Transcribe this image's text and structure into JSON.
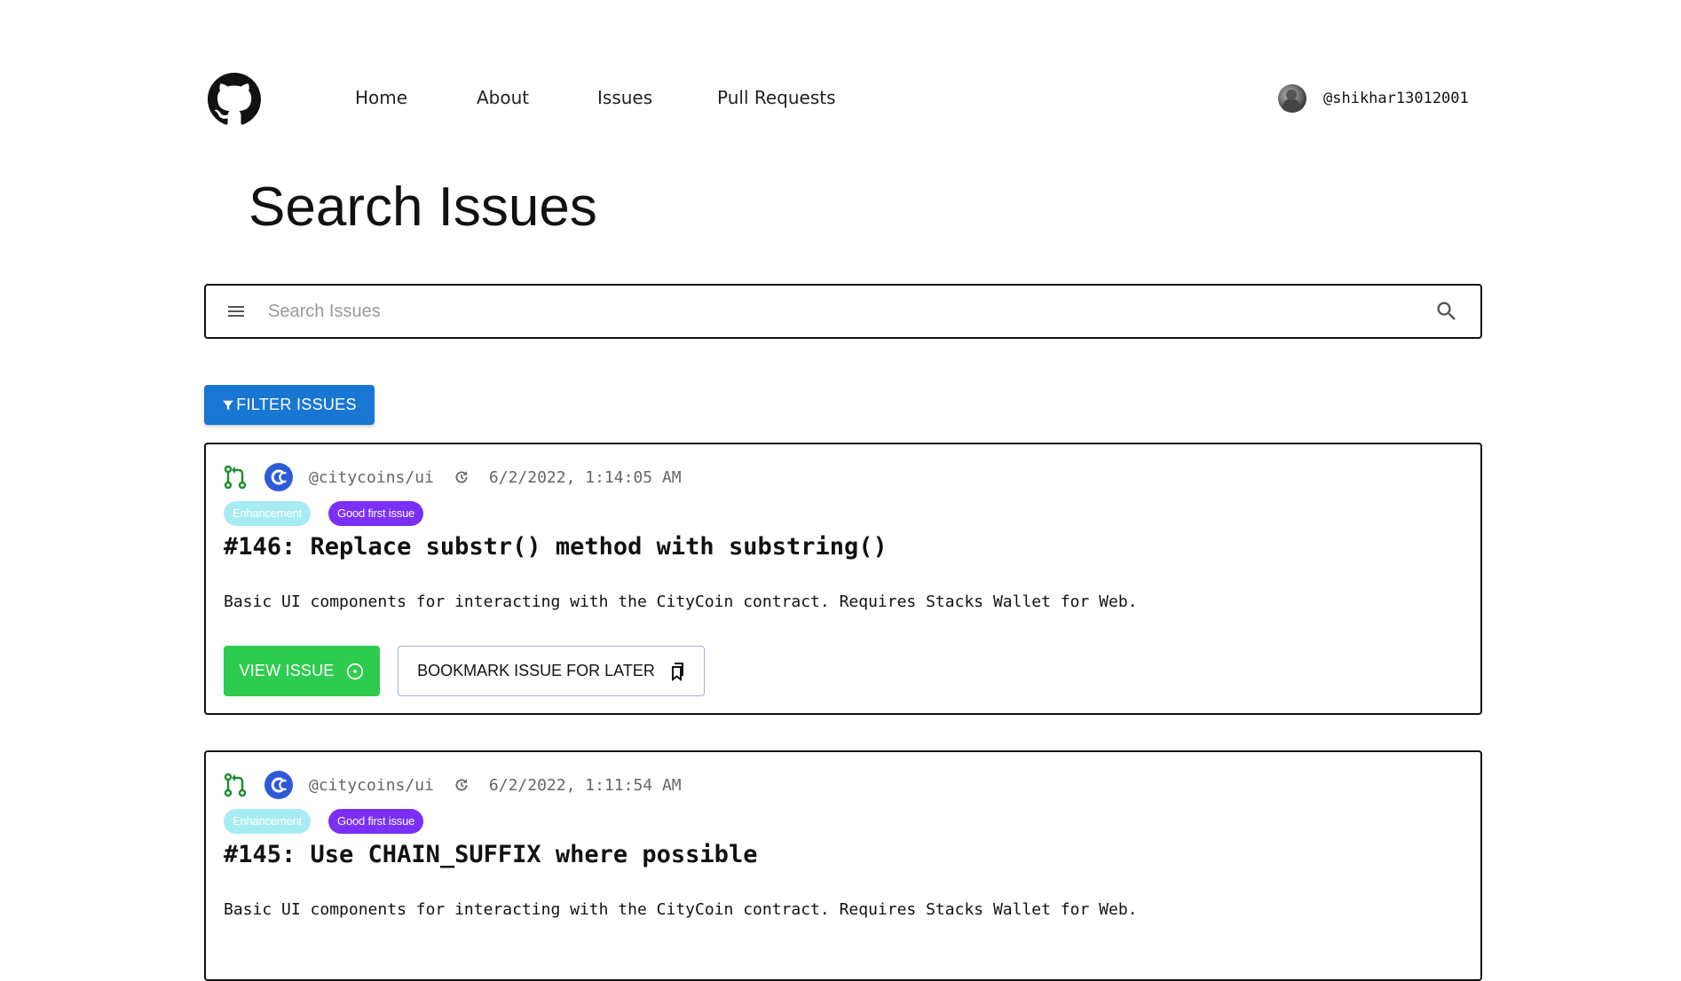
{
  "nav": {
    "links": [
      "Home",
      "About",
      "Issues",
      "Pull Requests"
    ],
    "username": "@shikhar13012001"
  },
  "page": {
    "title": "Search Issues"
  },
  "search": {
    "placeholder": "Search Issues",
    "value": ""
  },
  "filter": {
    "label": "FILTER ISSUES"
  },
  "issues": [
    {
      "repo": "@citycoins/ui",
      "date": "6/2/2022, 1:14:05 AM",
      "labels": [
        "Enhancement",
        "Good first issue"
      ],
      "title": "#146: Replace substr() method with substring()",
      "description": "Basic UI components for interacting with the CityCoin contract. Requires Stacks Wallet for Web.",
      "view_label": "VIEW ISSUE",
      "bookmark_label": "BOOKMARK ISSUE FOR LATER"
    },
    {
      "repo": "@citycoins/ui",
      "date": "6/2/2022, 1:11:54 AM",
      "labels": [
        "Enhancement",
        "Good first issue"
      ],
      "title": "#145: Use CHAIN_SUFFIX where possible",
      "description": "Basic UI components for interacting with the CityCoin contract. Requires Stacks Wallet for Web."
    }
  ],
  "colors": {
    "primary": "#1976d2",
    "success": "#2ecc4e",
    "badge_enhancement": "#a7ecf2",
    "badge_good_first_issue": "#7b2ff7",
    "pr_icon": "#1a8d2a",
    "org_icon": "#2d5bd8"
  },
  "icons": {
    "logo": "github-icon",
    "menu": "menu-icon",
    "search": "search-icon",
    "filter": "filter-icon",
    "pull_request": "pull-request-icon",
    "org": "citycoins-icon",
    "clock": "clock-icon",
    "view": "circle-dot-icon",
    "bookmark": "bookmark-icon"
  }
}
